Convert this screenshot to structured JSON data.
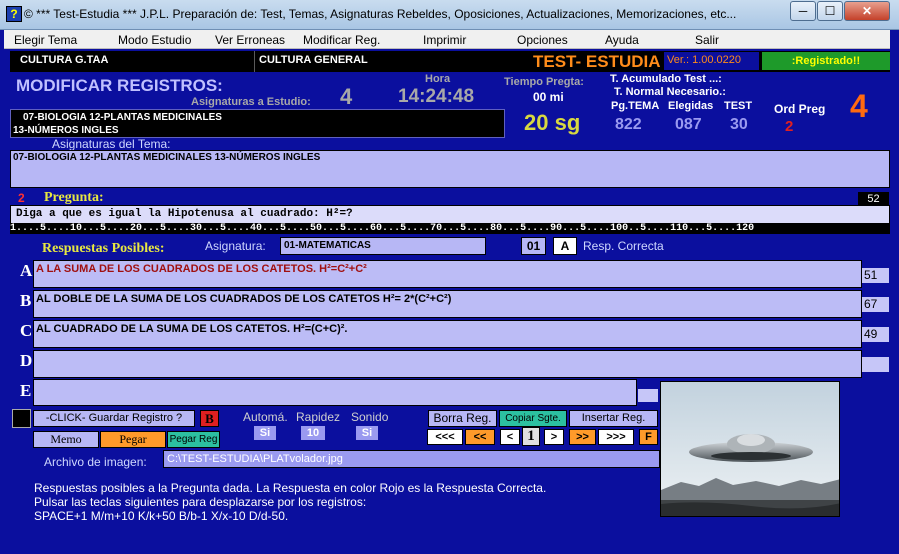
{
  "window": {
    "title": "©  *** Test-Estudia ***  J.P.L.   Preparación de: Test, Temas, Asignaturas Rebeldes, Oposiciones, Actualizaciones, Memorizaciones, etc...",
    "icon": "?",
    "minimize": "─",
    "maximize": "☐",
    "close": "✕"
  },
  "menu": [
    "Elegir Tema",
    "Modo Estudio",
    "Ver Erroneas",
    "Modificar Reg.",
    "Imprimir",
    "Opciones",
    "Ayuda",
    "Salir"
  ],
  "header": {
    "cultura_left": "CULTURA G.TAA",
    "cultura_general": "CULTURA GENERAL",
    "brand": "TEST- ESTUDIA",
    "version": "Ver.: 1.00.0220",
    "registered": ":Registrado!!"
  },
  "info": {
    "title": "MODIFICAR REGISTROS:",
    "asignaturas_label": "Asignaturas a Estudio:",
    "asignaturas_count": "4",
    "hora_label": "Hora",
    "hora_value": "14:24:48",
    "tiempo_label": "Tiempo Pregta:",
    "tiempo_mode": "00 mi",
    "tiempo_seconds": "20 sg",
    "acumulado_label": "T. Acumulado Test ...:",
    "normal_label": "T. Normal Necesario.:",
    "pg_tema_label": "Pg.TEMA",
    "elegidas_label": "Elegidas",
    "test_label": "TEST",
    "pg_tema_value": "822",
    "elegidas_value": "087",
    "test_value": "30",
    "ord_preg_label": "Ord Preg",
    "ord_preg_value": "4",
    "ord_preg_small": "2",
    "selected_subjects_line1": "07-BIOLOGIA  12-PLANTAS MEDICINALES",
    "selected_subjects_line2": "13-NÚMEROS INGLES"
  },
  "tema": {
    "label": "Asignaturas del Tema:",
    "value": "07-BIOLOGIA 12-PLANTAS MEDICINALES 13-NÚMEROS INGLES"
  },
  "pregunta": {
    "number": "2",
    "label": "Pregunta:",
    "length": "52",
    "text": "Diga a que es igual la Hipotenusa al cuadrado: H²=?",
    "ruler": "1....5....10...5....20...5....30...5....40...5....50...5....60...5....70...5....80...5....90...5....100..5....110...5....120"
  },
  "respuestas": {
    "label": "Respuestas Posibles:",
    "asignatura_label": "Asignatura:",
    "asignatura_value": "01-MATEMATICAS",
    "asignatura_code": "01",
    "correct_letter": "A",
    "correct_label": "Resp. Correcta",
    "items": [
      {
        "letter": "A",
        "text": "A LA SUMA DE LOS CUADRADOS DE LOS CATETOS. H²=C²+C²",
        "count": "51"
      },
      {
        "letter": "B",
        "text": "AL DOBLE DE LA SUMA DE LOS CUADRADOS DE LOS CATETOS  H²= 2*(C²+C²)",
        "count": "67"
      },
      {
        "letter": "C",
        "text": "AL CUADRADO DE LA SUMA DE LOS CATETOS. H²=(C+C)².",
        "count": "49"
      },
      {
        "letter": "D",
        "text": "",
        "count": ""
      },
      {
        "letter": "E",
        "text": "",
        "count": ""
      }
    ]
  },
  "controls": {
    "guardar": "-CLICK-  Guardar Registro ?",
    "b_button": "B",
    "memo": "Memo",
    "pegar": "Pegar",
    "pegar_reg": "Pegar Reg",
    "automa_label": "Automá.",
    "rapidez_label": "Rapidez",
    "sonido_label": "Sonido",
    "automa_value": "Si",
    "rapidez_value": "10",
    "sonido_value": "Si",
    "borra_reg": "Borra Reg.",
    "copiar_sgte": "Copiar Sgte.",
    "insertar_reg": "Insertar Reg.",
    "nav_first": "<<<",
    "nav_back10": "<<",
    "nav_prev": "<",
    "nav_current": "1",
    "nav_next": ">",
    "nav_fwd10": ">>",
    "nav_last": ">>>",
    "nav_f": "F",
    "archivo_label": "Archivo de imagen:",
    "archivo_value": "C:\\TEST-ESTUDIA\\PLATvolador.jpg"
  },
  "help": {
    "line1": "Respuestas posibles a la Pregunta dada. La Respuesta en color Rojo es la Respuesta Correcta.",
    "line2": "Pulsar las teclas siguientes para desplazarse por los registros:",
    "line3": "SPACE+1 M/m+10 K/k+50      B/b-1 X/x-10 D/d-50."
  },
  "colors": {
    "background": "#0b0f9e",
    "lavender": "#b7b7f5",
    "brand_orange": "#ff8c1a",
    "correct_red": "#a01010"
  }
}
